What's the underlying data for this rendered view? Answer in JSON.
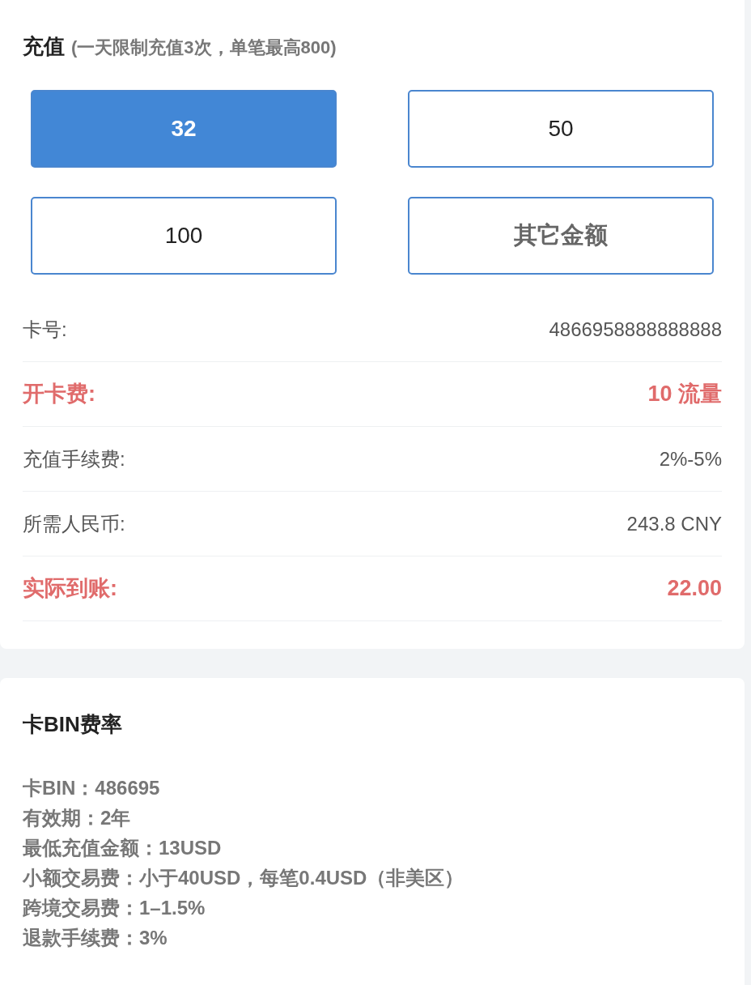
{
  "recharge": {
    "title": "充值",
    "note": "(一天限制充值3次，单笔最高800)",
    "amounts": [
      {
        "label": "32",
        "selected": true,
        "kind": "preset"
      },
      {
        "label": "50",
        "selected": false,
        "kind": "preset"
      },
      {
        "label": "100",
        "selected": false,
        "kind": "preset"
      },
      {
        "label": "其它金额",
        "selected": false,
        "kind": "custom"
      }
    ],
    "rows": [
      {
        "label": "卡号:",
        "value": "4866958888888888",
        "highlight": false
      },
      {
        "label": "开卡费:",
        "value": "10 流量",
        "highlight": true
      },
      {
        "label": "充值手续费:",
        "value": "2%-5%",
        "highlight": false
      },
      {
        "label": "所需人民币:",
        "value": "243.8 CNY",
        "highlight": false
      },
      {
        "label": "实际到账:",
        "value": "22.00",
        "highlight": true
      }
    ]
  },
  "bin_rates": {
    "title": "卡BIN费率",
    "lines": [
      "卡BIN：486695",
      "有效期：2年",
      "最低充值金额：13USD",
      "小额交易费：小于40USD，每笔0.4USD（非美区）",
      "跨境交易费：1–1.5%",
      "退款手续费：3%"
    ]
  }
}
